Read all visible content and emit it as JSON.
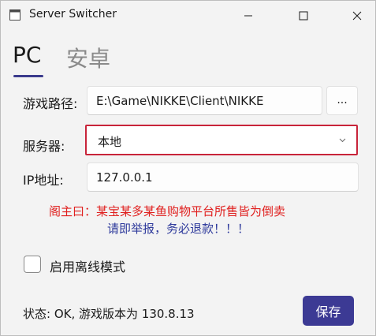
{
  "window": {
    "title": "Server Switcher"
  },
  "tabs": [
    {
      "label": "PC",
      "selected": true
    },
    {
      "label": "安卓",
      "selected": false
    }
  ],
  "form": {
    "game_path_label": "游戏路径:",
    "game_path_value": "E:\\Game\\NIKKE\\Client\\NIKKE",
    "browse_label": "...",
    "server_label": "服务器:",
    "server_value": "本地",
    "ip_label": "IP地址:",
    "ip_value": "127.0.0.1"
  },
  "notice": {
    "line1": "阁主曰：某宝某多某鱼购物平台所售皆为倒卖",
    "line2": "请即举报，务必退款！！！"
  },
  "offline_mode": {
    "label": "启用离线模式",
    "checked": false
  },
  "status": {
    "text": "状态: OK, 游戏版本为 130.8.13"
  },
  "save_label": "保存",
  "colors": {
    "accent": "#3c3a94",
    "highlight_border": "#c8243a",
    "warning_text": "#e0201f",
    "info_text": "#2f3b9c"
  }
}
